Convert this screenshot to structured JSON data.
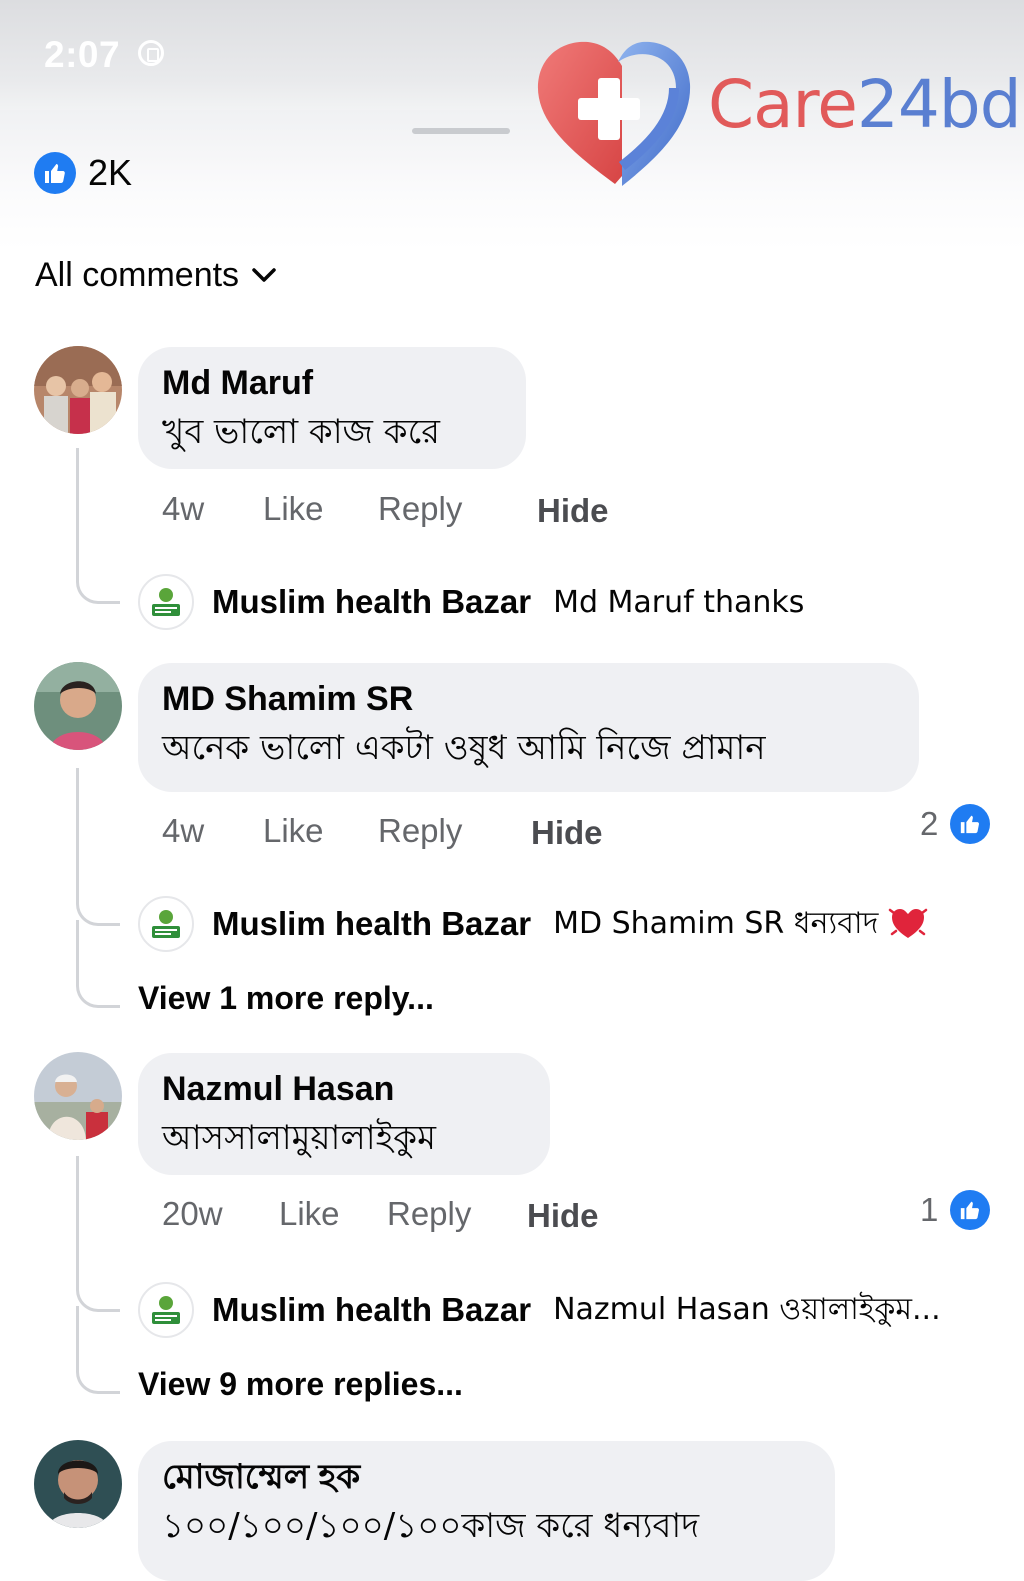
{
  "status_bar": {
    "time": "2:07"
  },
  "brand": {
    "part1": "Care",
    "part2": "24bd"
  },
  "post_reactions": {
    "count": "2K"
  },
  "filter": {
    "label": "All comments"
  },
  "comments": [
    {
      "author": "Md Maruf",
      "text": "খুব ভালো কাজ করে",
      "time": "4w",
      "like": "Like",
      "reply": "Reply",
      "hide": "Hide",
      "reply_preview": {
        "author": "Muslim health Bazar",
        "text": "Md Maruf thanks"
      }
    },
    {
      "author": "MD Shamim SR",
      "text": "অনেক ভালো একটা ওষুধ আমি নিজে প্রামান",
      "time": "4w",
      "like": "Like",
      "reply": "Reply",
      "hide": "Hide",
      "reactions": "2",
      "reply_preview": {
        "author": "Muslim health Bazar",
        "text": "MD Shamim SR ধন্যবাদ"
      },
      "view_more": "View 1 more reply..."
    },
    {
      "author": "Nazmul Hasan",
      "text": "আসসালামুয়ালাইকুম",
      "time": "20w",
      "like": "Like",
      "reply": "Reply",
      "hide": "Hide",
      "reactions": "1",
      "reply_preview": {
        "author": "Muslim health Bazar",
        "text": "Nazmul Hasan ওয়ালাইকুম..."
      },
      "view_more": "View 9 more replies..."
    },
    {
      "author": "মোজাম্মেল হক",
      "text": "১০০/১০০/১০০/১০০কাজ করে ধন্যবাদ"
    }
  ],
  "colors": {
    "accent_blue": "#1f7cf2",
    "bubble_bg": "#eff0f3",
    "secondary_text": "#65676b"
  },
  "icons": [
    "like-thumb-icon",
    "chevron-down-icon",
    "heart-cross-logo-icon",
    "heart-emoji-icon"
  ]
}
